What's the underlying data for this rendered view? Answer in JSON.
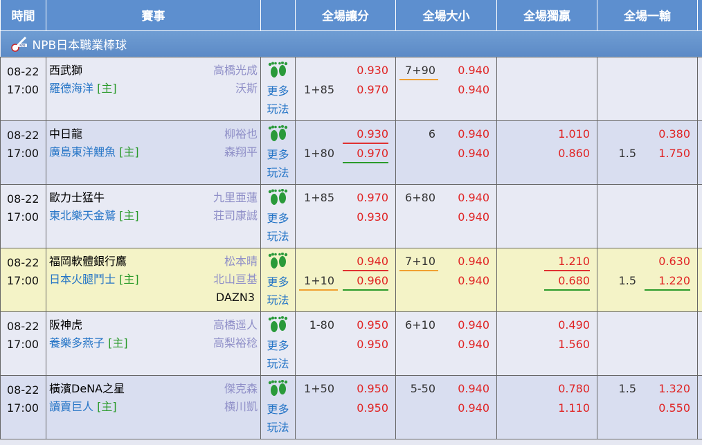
{
  "header": {
    "time": "時間",
    "event": "賽事",
    "handicap": "全場讓分",
    "total": "全場大小",
    "moneyline": "全場獨贏",
    "one_lose": "全場一輸"
  },
  "league": {
    "name": "NPB日本職業棒球",
    "logo_text": "NPB"
  },
  "more_label": "更多玩法",
  "rows": [
    {
      "date": "08-22",
      "time": "17:00",
      "away": "西武獅",
      "home": "羅德海洋",
      "home_tag": "[主]",
      "away_pitcher": "高橋光成",
      "home_pitcher": "沃斯",
      "tv": "",
      "hc1_line": "",
      "hc1_price": "0.930",
      "hc2_line": "1+85",
      "hc2_price": "0.970",
      "ou1_line": "7+90",
      "ou1_price": "0.940",
      "ou2_line": "",
      "ou2_price": "0.940",
      "ml1_price": "",
      "ml2_price": "",
      "ol1_line": "",
      "ol1_price": "",
      "ol2_line": "",
      "ol2_price": ""
    },
    {
      "date": "08-22",
      "time": "17:00",
      "away": "中日龍",
      "home": "廣島東洋鯉魚",
      "home_tag": "[主]",
      "away_pitcher": "柳裕也",
      "home_pitcher": "森翔平",
      "tv": "",
      "hc1_line": "",
      "hc1_price": "0.930",
      "hc2_line": "1+80",
      "hc2_price": "0.970",
      "ou1_line": "6",
      "ou1_price": "0.940",
      "ou2_line": "",
      "ou2_price": "0.940",
      "ml1_price": "1.010",
      "ml2_price": "0.860",
      "ol1_line": "",
      "ol1_price": "0.380",
      "ol2_line": "1.5",
      "ol2_price": "1.750"
    },
    {
      "date": "08-22",
      "time": "17:00",
      "away": "歐力士猛牛",
      "home": "東北樂天金鷲",
      "home_tag": "[主]",
      "away_pitcher": "九里亜蓮",
      "home_pitcher": "荘司康誠",
      "tv": "",
      "hc1_line": "1+85",
      "hc1_price": "0.970",
      "hc2_line": "",
      "hc2_price": "0.930",
      "ou1_line": "6+80",
      "ou1_price": "0.940",
      "ou2_line": "",
      "ou2_price": "0.940",
      "ml1_price": "",
      "ml2_price": "",
      "ol1_line": "",
      "ol1_price": "",
      "ol2_line": "",
      "ol2_price": ""
    },
    {
      "date": "08-22",
      "time": "17:00",
      "away": "福岡軟體銀行鷹",
      "home": "日本火腿鬥士",
      "home_tag": "[主]",
      "away_pitcher": "松本晴",
      "home_pitcher": "北山亘基",
      "tv": "DAZN3",
      "hc1_line": "",
      "hc1_price": "0.940",
      "hc2_line": "1+10",
      "hc2_price": "0.960",
      "ou1_line": "7+10",
      "ou1_price": "0.940",
      "ou2_line": "",
      "ou2_price": "0.940",
      "ml1_price": "1.210",
      "ml2_price": "0.680",
      "ol1_line": "",
      "ol1_price": "0.630",
      "ol2_line": "1.5",
      "ol2_price": "1.220"
    },
    {
      "date": "08-22",
      "time": "17:00",
      "away": "阪神虎",
      "home": "養樂多燕子",
      "home_tag": "[主]",
      "away_pitcher": "高橋遥人",
      "home_pitcher": "高梨裕稔",
      "tv": "",
      "hc1_line": "1-80",
      "hc1_price": "0.950",
      "hc2_line": "",
      "hc2_price": "0.950",
      "ou1_line": "6+10",
      "ou1_price": "0.940",
      "ou2_line": "",
      "ou2_price": "0.940",
      "ml1_price": "0.490",
      "ml2_price": "1.560",
      "ol1_line": "",
      "ol1_price": "",
      "ol2_line": "",
      "ol2_price": ""
    },
    {
      "date": "08-22",
      "time": "17:00",
      "away": "橫濱DeNA之星",
      "home": "讀賣巨人",
      "home_tag": "[主]",
      "away_pitcher": "傑克森",
      "home_pitcher": "横川凱",
      "tv": "",
      "hc1_line": "1+50",
      "hc1_price": "0.950",
      "hc2_line": "",
      "hc2_price": "0.950",
      "ou1_line": "5-50",
      "ou1_price": "0.940",
      "ou2_line": "",
      "ou2_price": "0.940",
      "ml1_price": "0.780",
      "ml2_price": "1.110",
      "ol1_line": "1.5",
      "ol1_price": "1.320",
      "ol2_line": "",
      "ol2_price": "0.550"
    }
  ]
}
